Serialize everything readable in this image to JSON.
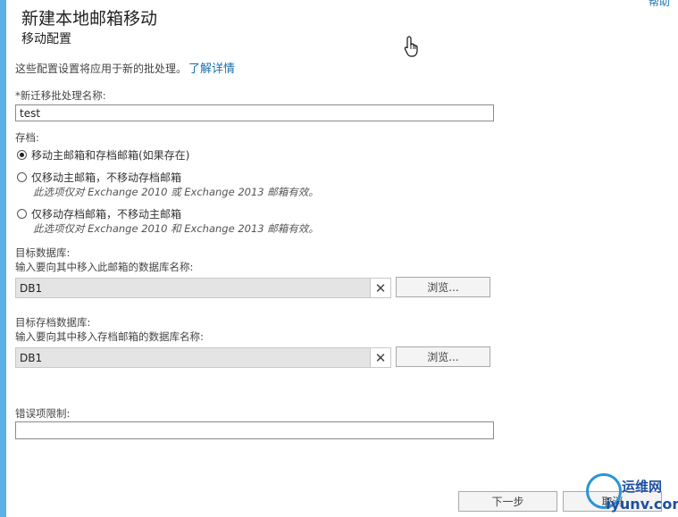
{
  "header": {
    "help": "帮助",
    "title": "新建本地邮箱移动",
    "subtitle": "移动配置"
  },
  "intro": {
    "text": "这些配置设置将应用于新的批处理。",
    "learn_more": "了解详情"
  },
  "batch_name": {
    "label": "*新迁移批处理名称:",
    "value": "test"
  },
  "archive": {
    "label": "存档:",
    "options": [
      {
        "label": "移动主邮箱和存档邮箱(如果存在)",
        "note": "",
        "checked": true
      },
      {
        "label": "仅移动主邮箱，不移动存档邮箱",
        "note": "此选项仅对 Exchange 2010 或 Exchange 2013 邮箱有效。",
        "checked": false
      },
      {
        "label": "仅移动存档邮箱，不移动主邮箱",
        "note": "此选项仅对 Exchange 2010 和 Exchange 2013 邮箱有效。",
        "checked": false
      }
    ]
  },
  "target_db": {
    "label": "目标数据库:",
    "hint": "输入要向其中移入此邮箱的数据库名称:",
    "value": "DB1",
    "browse": "浏览..."
  },
  "target_archive_db": {
    "label": "目标存档数据库:",
    "hint": "输入要向其中移入存档邮箱的数据库名称:",
    "value": "DB1",
    "browse": "浏览..."
  },
  "error_limit": {
    "label": "错误项限制:",
    "value": ""
  },
  "footer": {
    "next": "下一步",
    "cancel": "取消"
  },
  "watermark": {
    "top": "运维网",
    "bottom": "iyunv.com"
  },
  "colors": {
    "accent_bar": "#5ab0e6",
    "link": "#1a6fa8"
  }
}
